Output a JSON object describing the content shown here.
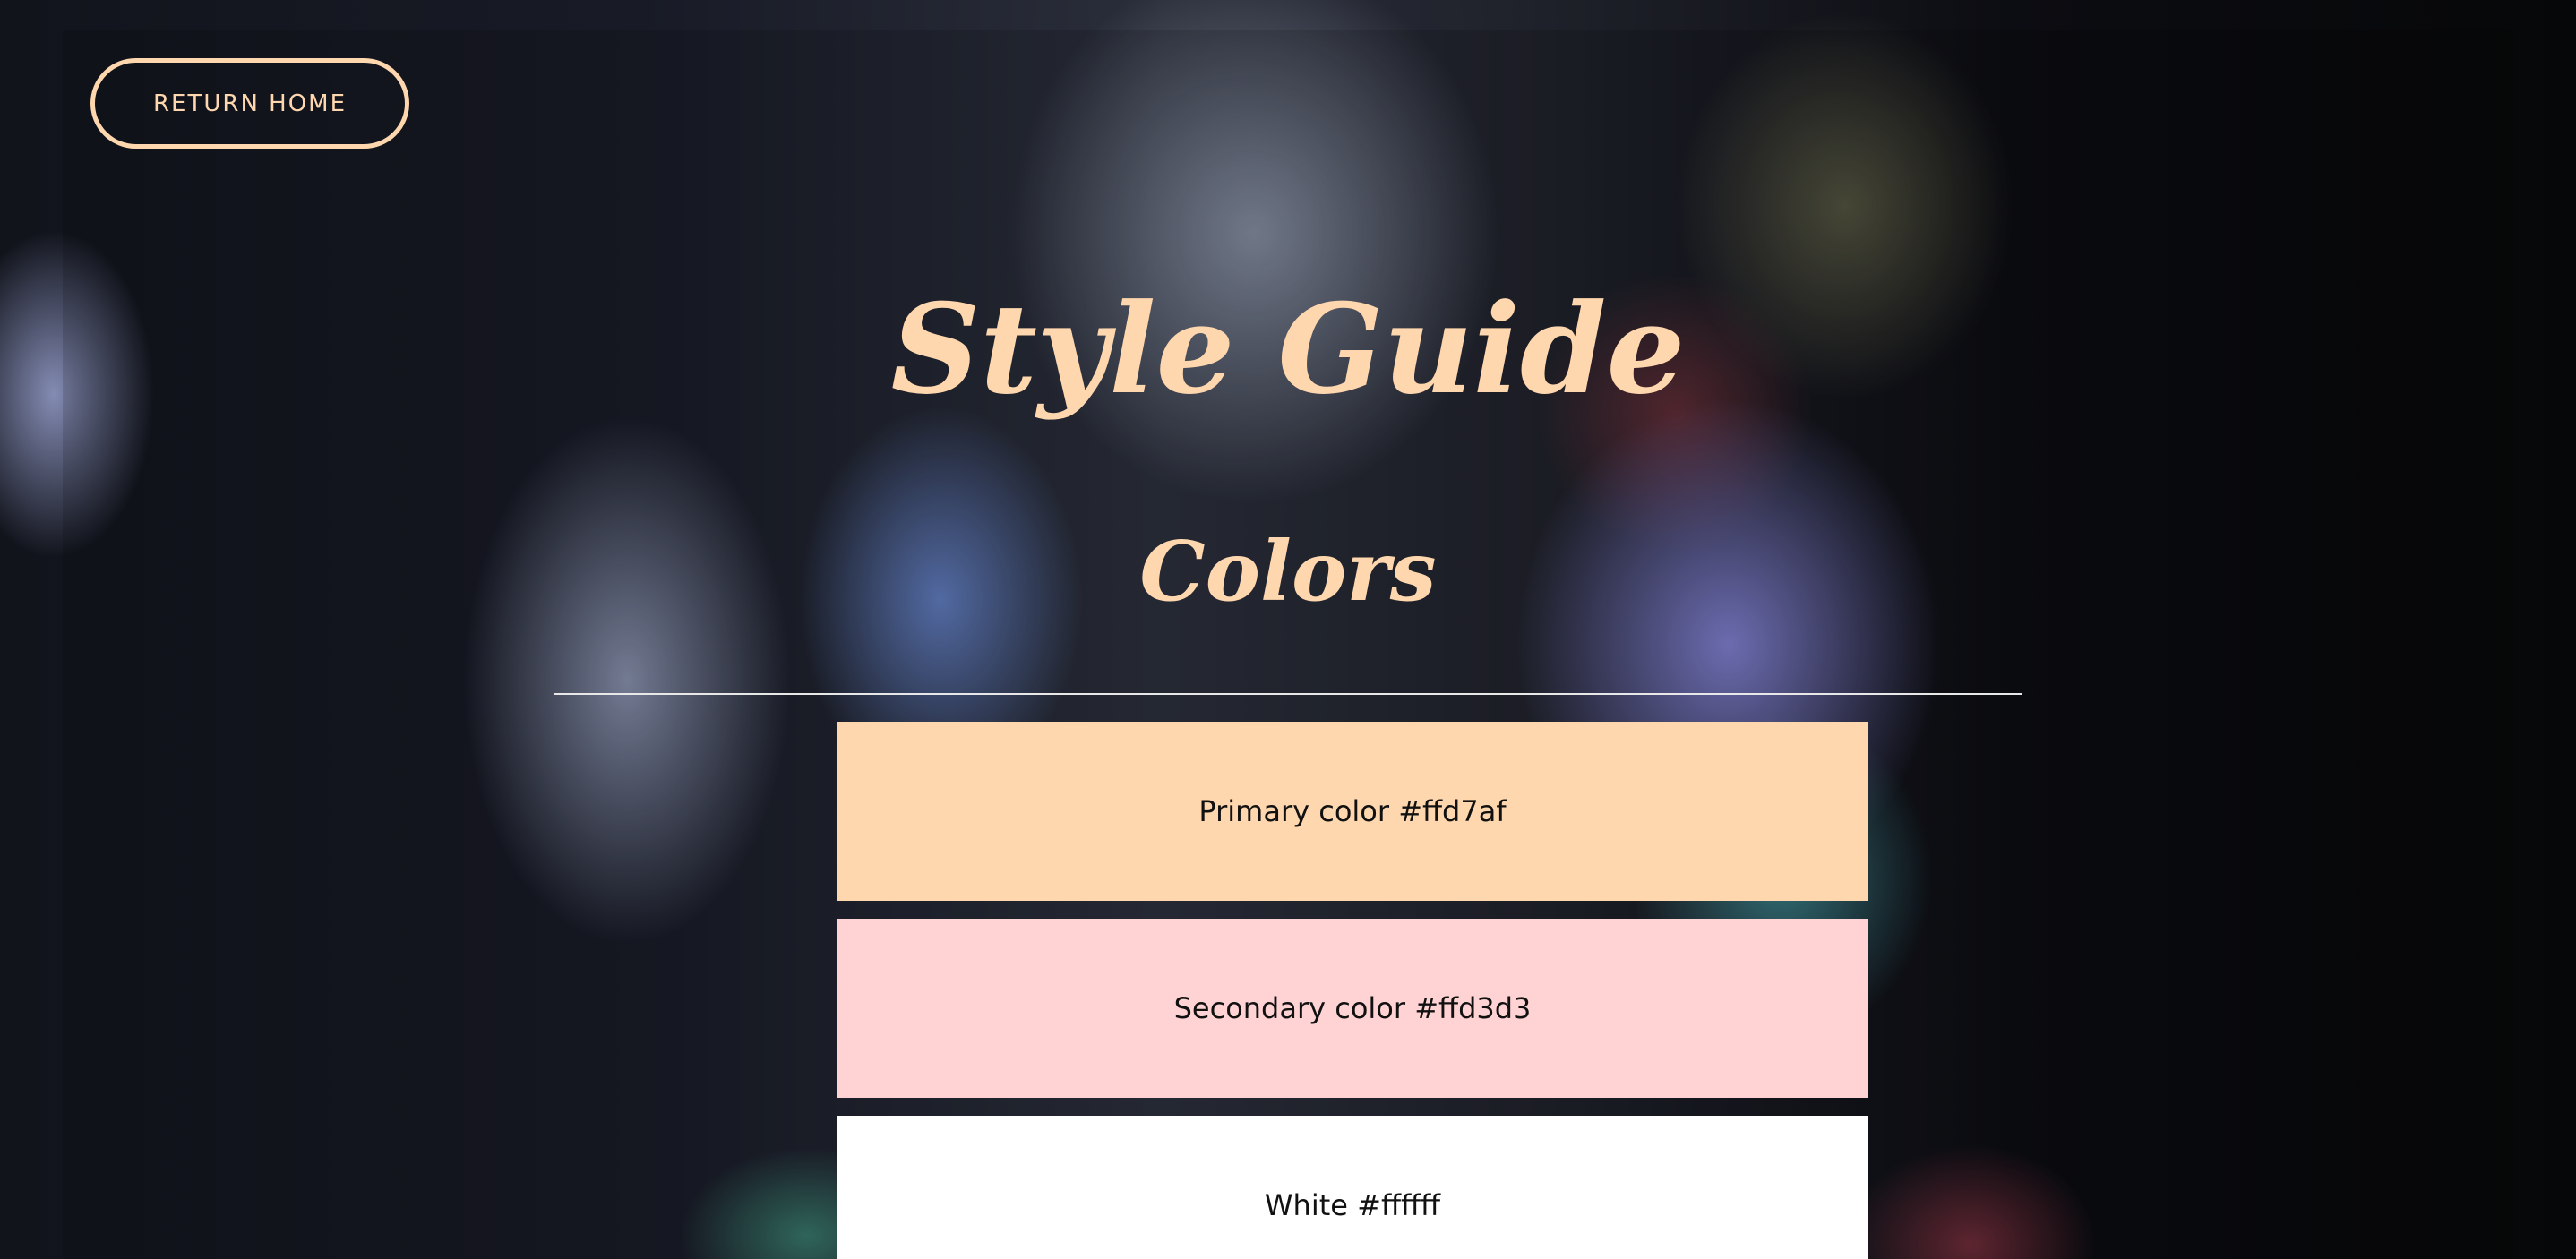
{
  "nav": {
    "return_home_label": "RETURN HOME"
  },
  "header": {
    "title": "Style Guide",
    "section_title": "Colors"
  },
  "colors": [
    {
      "label": "Primary color #ffd7af",
      "hex": "#ffd7af"
    },
    {
      "label": "Secondary color #ffd3d3",
      "hex": "#ffd3d3"
    },
    {
      "label": "White #ffffff",
      "hex": "#ffffff"
    }
  ],
  "theme": {
    "accent": "#ffd7af",
    "divider": "#e8e8e8"
  }
}
